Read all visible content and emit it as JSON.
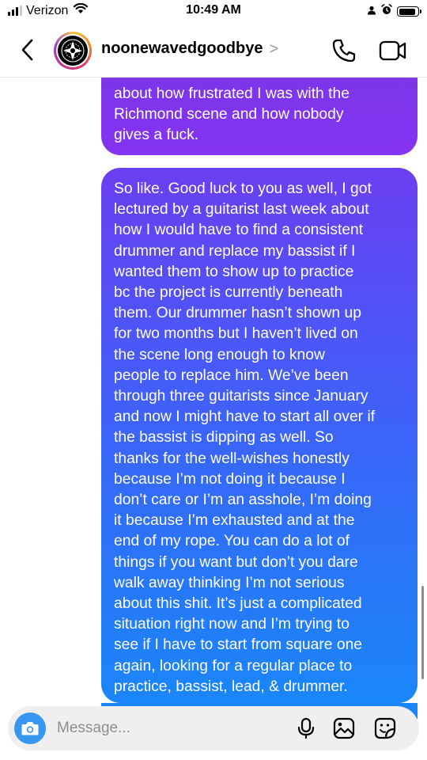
{
  "status_bar": {
    "carrier": "Verizon",
    "time": "10:49 AM",
    "signal_bars": 3,
    "battery_level": 0.9
  },
  "header": {
    "username": "noonewavedgoodbye",
    "chevron": ">",
    "icons": [
      "back-arrow-icon",
      "phone-icon",
      "video-camera-icon"
    ]
  },
  "messages": [
    {
      "sender": "me",
      "text": "about how frustrated I was with the\nRichmond scene and how nobody\ngives a fuck."
    },
    {
      "sender": "me",
      "text": "So like. Good luck to you as well, I got\nlectured by a guitarist last week about\nhow I would have to find a consistent\ndrummer and replace my bassist if I\nwanted them to show up to practice\nbc the project is currently beneath\nthem. Our drummer hasn’t shown up\nfor two months but I haven’t lived on\nthe scene long enough to know\npeople to replace him. We’ve been\nthrough three guitarists since January\nand now I might have to start all over if\nthe bassist is dipping as well. So\nthanks for the well-wishes honestly\nbecause I’m not doing it because I\ndon’t care or I’m an asshole, I’m doing\nit because I’m exhausted and at the\nend of my rope. You can do a lot of\nthings if you want but don’t you dare\nwalk away thinking I’m not serious\nabout this shit. It’s just a complicated\nsituation right now and I’m trying to\nsee if I have to start from square one\nagain, looking for a regular place to\npractice, bassist, lead, & drummer."
    }
  ],
  "composer": {
    "placeholder": "Message...",
    "value": "",
    "icons": [
      "camera-icon",
      "microphone-icon",
      "gallery-icon",
      "sticker-icon"
    ]
  },
  "colors": {
    "camera_button": "#3797f0",
    "bubble_top": "#7a36e6",
    "bubble_bottom": "#1a86f9"
  }
}
